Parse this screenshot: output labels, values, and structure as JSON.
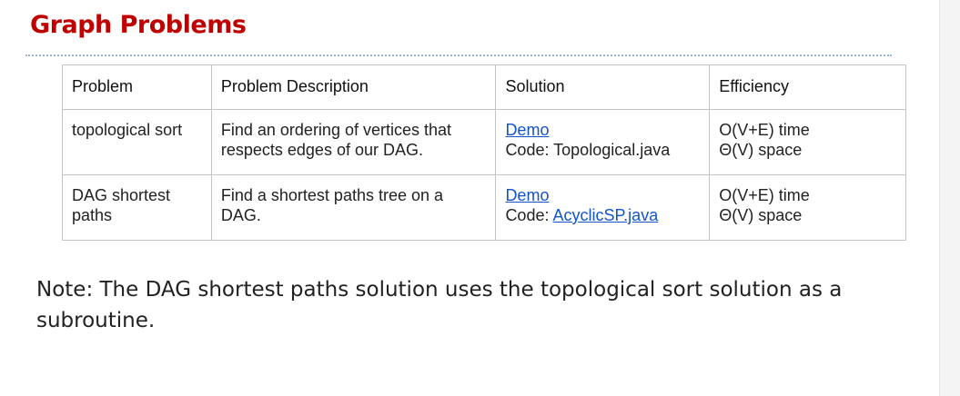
{
  "slide": {
    "title": "Graph Problems",
    "accent_color": "#c00000",
    "link_color": "#1155cc"
  },
  "table": {
    "headers": [
      "Problem",
      "Problem Description",
      "Solution",
      "Efficiency"
    ],
    "rows": [
      {
        "problem": "topological sort",
        "description": "Find an ordering of vertices that respects edges of our DAG.",
        "solution_link": "Demo",
        "solution_code_prefix": "Code: ",
        "solution_code": "Topological.java",
        "time": "O(V+E) time",
        "space": "Θ(V) space"
      },
      {
        "problem": "DAG shortest paths",
        "description": "Find a shortest paths tree on a DAG.",
        "solution_link": "Demo",
        "solution_code_prefix": "Code: ",
        "solution_code": "AcyclicSP.java",
        "time": "O(V+E) time",
        "space": "Θ(V) space"
      }
    ]
  },
  "note": "Note: The DAG shortest paths solution uses the topological sort solution as a subroutine."
}
